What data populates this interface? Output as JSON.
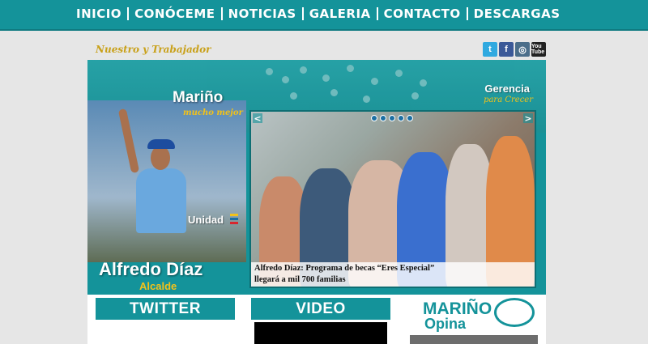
{
  "nav": {
    "items": [
      "INICIO",
      "CONÓCEME",
      "NOTICIAS",
      "GALERIA",
      "CONTACTO",
      "DESCARGAS"
    ]
  },
  "header": {
    "slogan": "Nuestro y Trabajador",
    "social": {
      "twitter": "t",
      "facebook": "f",
      "instagram": "◎",
      "youtube": "You Tube"
    }
  },
  "banner": {
    "marino": "Mariño",
    "marino_sub": "mucho mejor",
    "gerencia": "Gerencia",
    "gerencia_sub": "para Crecer",
    "unidad": "Unidad",
    "name": "Alfredo Díaz",
    "role": "Alcalde"
  },
  "slider": {
    "prev": "<",
    "next": ">",
    "dots": 5,
    "caption_line1": "Alfredo Díaz: Programa de becas “Eres Especial”",
    "caption_line2": "llegará a mil 700 familias"
  },
  "sections": {
    "twitter": "TWITTER",
    "video": "VIDEO",
    "opina_title": "MARIÑO",
    "opina_sub": "Opina"
  },
  "colors": {
    "teal": "#14939a",
    "gold": "#f2c21a"
  }
}
